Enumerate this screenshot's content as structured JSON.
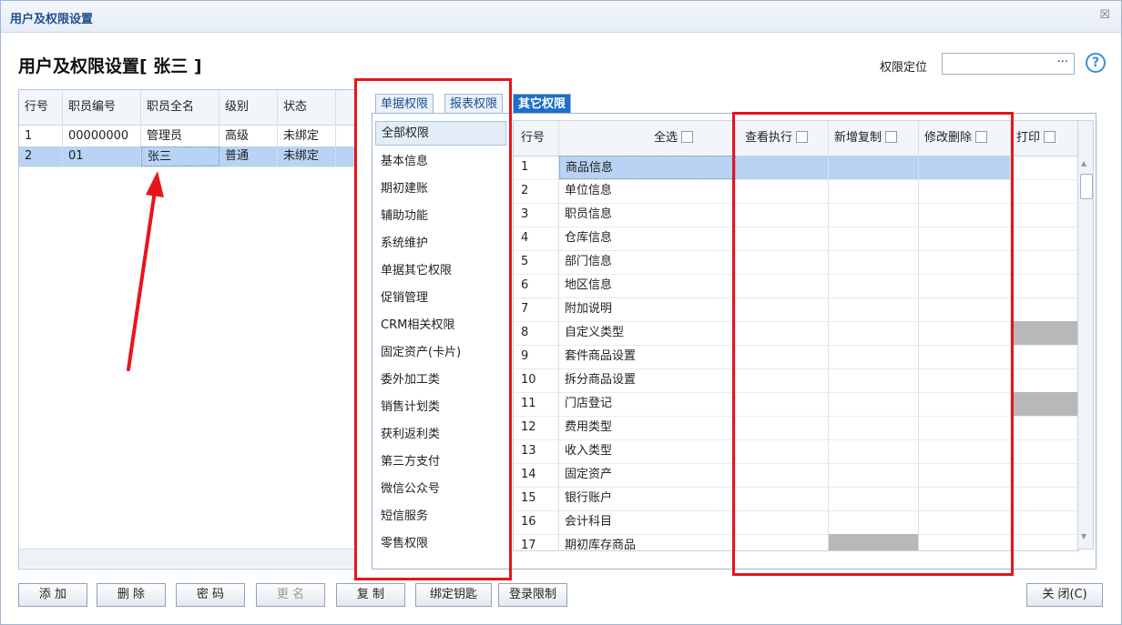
{
  "window": {
    "title": "用户及权限设置",
    "close_glyph": "☒"
  },
  "heading": "用户及权限设置[ 张三 ]",
  "locate": {
    "label": "权限定位",
    "ellipsis": "···",
    "help": "?"
  },
  "users": {
    "columns": [
      "行号",
      "职员编号",
      "职员全名",
      "级别",
      "状态"
    ],
    "rows": [
      [
        "1",
        "00000000",
        "管理员",
        "高级",
        "未绑定"
      ],
      [
        "2",
        "01",
        "张三",
        "普通",
        "未绑定"
      ]
    ]
  },
  "tabs": [
    "单据权限",
    "报表权限",
    "其它权限"
  ],
  "categories": [
    "全部权限",
    "基本信息",
    "期初建账",
    "辅助功能",
    "系统维护",
    "单据其它权限",
    "促销管理",
    "CRM相关权限",
    "固定资产(卡片)",
    "委外加工类",
    "销售计划类",
    "获利返利类",
    "第三方支付",
    "微信公众号",
    "短信服务",
    "零售权限"
  ],
  "grid": {
    "columns": [
      "行号",
      "全选",
      "查看执行",
      "新增复制",
      "修改删除",
      "打印"
    ],
    "rows": [
      [
        "1",
        "商品信息"
      ],
      [
        "2",
        "单位信息"
      ],
      [
        "3",
        "职员信息"
      ],
      [
        "4",
        "仓库信息"
      ],
      [
        "5",
        "部门信息"
      ],
      [
        "6",
        "地区信息"
      ],
      [
        "7",
        "附加说明"
      ],
      [
        "8",
        "自定义类型"
      ],
      [
        "9",
        "套件商品设置"
      ],
      [
        "10",
        "拆分商品设置"
      ],
      [
        "11",
        "门店登记"
      ],
      [
        "12",
        "费用类型"
      ],
      [
        "13",
        "收入类型"
      ],
      [
        "14",
        "固定资产"
      ],
      [
        "15",
        "银行账户"
      ],
      [
        "16",
        "会计科目"
      ],
      [
        "17",
        "期初库存商品"
      ]
    ]
  },
  "buttons": [
    "添 加",
    "删 除",
    "密 码",
    "更 名",
    "复 制",
    "绑定钥匙",
    "登录限制",
    "关 闭(C)"
  ],
  "colors": {
    "annotation": "#e8141b",
    "active_tab": "#1e6fc8",
    "selection": "#b8d3f3"
  }
}
